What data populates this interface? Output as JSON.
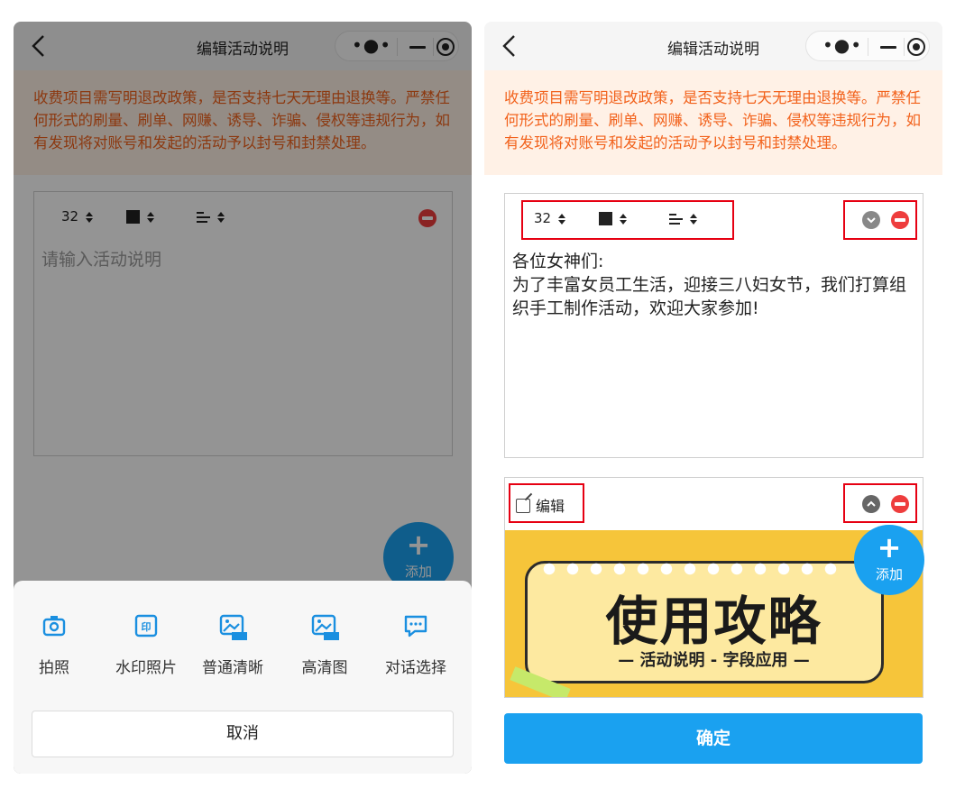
{
  "left_screen": {
    "nav": {
      "title": "编辑活动说明"
    },
    "notice": "收费项目需写明退改政策，是否支持七天无理由退换等。严禁任何形式的刷量、刷单、网赚、诱导、诈骗、侵权等违规行为，如有发现将对账号和发起的活动予以封号和封禁处理。",
    "editor": {
      "font_size": "32",
      "placeholder": "请输入活动说明"
    },
    "fab": {
      "label": "添加"
    },
    "sheet": {
      "options": [
        {
          "label": "拍照",
          "icon": "camera-icon"
        },
        {
          "label": "水印照片",
          "icon": "watermark-icon"
        },
        {
          "label": "普通清晰",
          "icon": "album-icon",
          "badge": "相册"
        },
        {
          "label": "高清图",
          "icon": "album-hd-icon",
          "badge": "相册"
        },
        {
          "label": "对话选择",
          "icon": "chat-icon"
        }
      ],
      "cancel": "取消"
    }
  },
  "right_screen": {
    "nav": {
      "title": "编辑活动说明"
    },
    "notice": "收费项目需写明退改政策，是否支持七天无理由退换等。严禁任何形式的刷量、刷单、网赚、诱导、诈骗、侵权等违规行为，如有发现将对账号和发起的活动予以封号和封禁处理。",
    "editor": {
      "font_size": "32",
      "content_line1": "各位女神们:",
      "content_line2": "为了丰富女员工生活，迎接三八妇女节，我们打算组织手工制作活动，欢迎大家参加!"
    },
    "image_block": {
      "edit_label": "编辑",
      "banner_title": "使用攻略",
      "banner_subtitle": "— 活动说明 - 字段应用 —"
    },
    "fab": {
      "label": "添加"
    },
    "confirm": "确定"
  },
  "colors": {
    "accent_blue": "#1aa1f0",
    "notice_text": "#f2621c",
    "notice_bg": "#fff1e6",
    "delete_red": "#ee3d3d",
    "highlight_red": "#e60012"
  }
}
